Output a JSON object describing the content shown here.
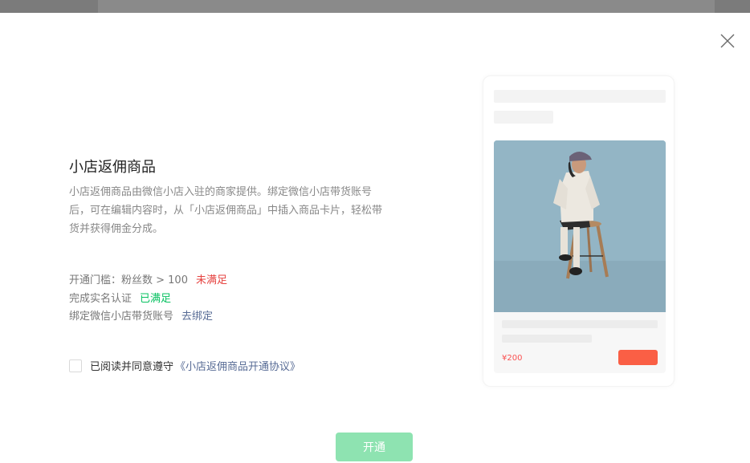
{
  "dialog": {
    "title": "小店返佣商品",
    "description": "小店返佣商品由微信小店入驻的商家提供。绑定微信小店带货账号后，可在编辑内容时，从「小店返佣商品」中插入商品卡片，轻松带货并获得佣金分成。",
    "requirements": [
      {
        "label": "开通门槛：粉丝数 > 100",
        "status": "未满足",
        "status_color": "#e64340"
      },
      {
        "label": "完成实名认证",
        "status": "已满足",
        "status_color": "#07c160"
      },
      {
        "label": "绑定微信小店带货账号",
        "status": "去绑定",
        "status_color": "#576b95"
      }
    ],
    "agreement_prefix": "已阅读并同意遵守",
    "agreement_link": "《小店返佣商品开通协议》",
    "open_button": "开通",
    "accent_color": "#07c160"
  },
  "preview": {
    "price": "¥200"
  }
}
